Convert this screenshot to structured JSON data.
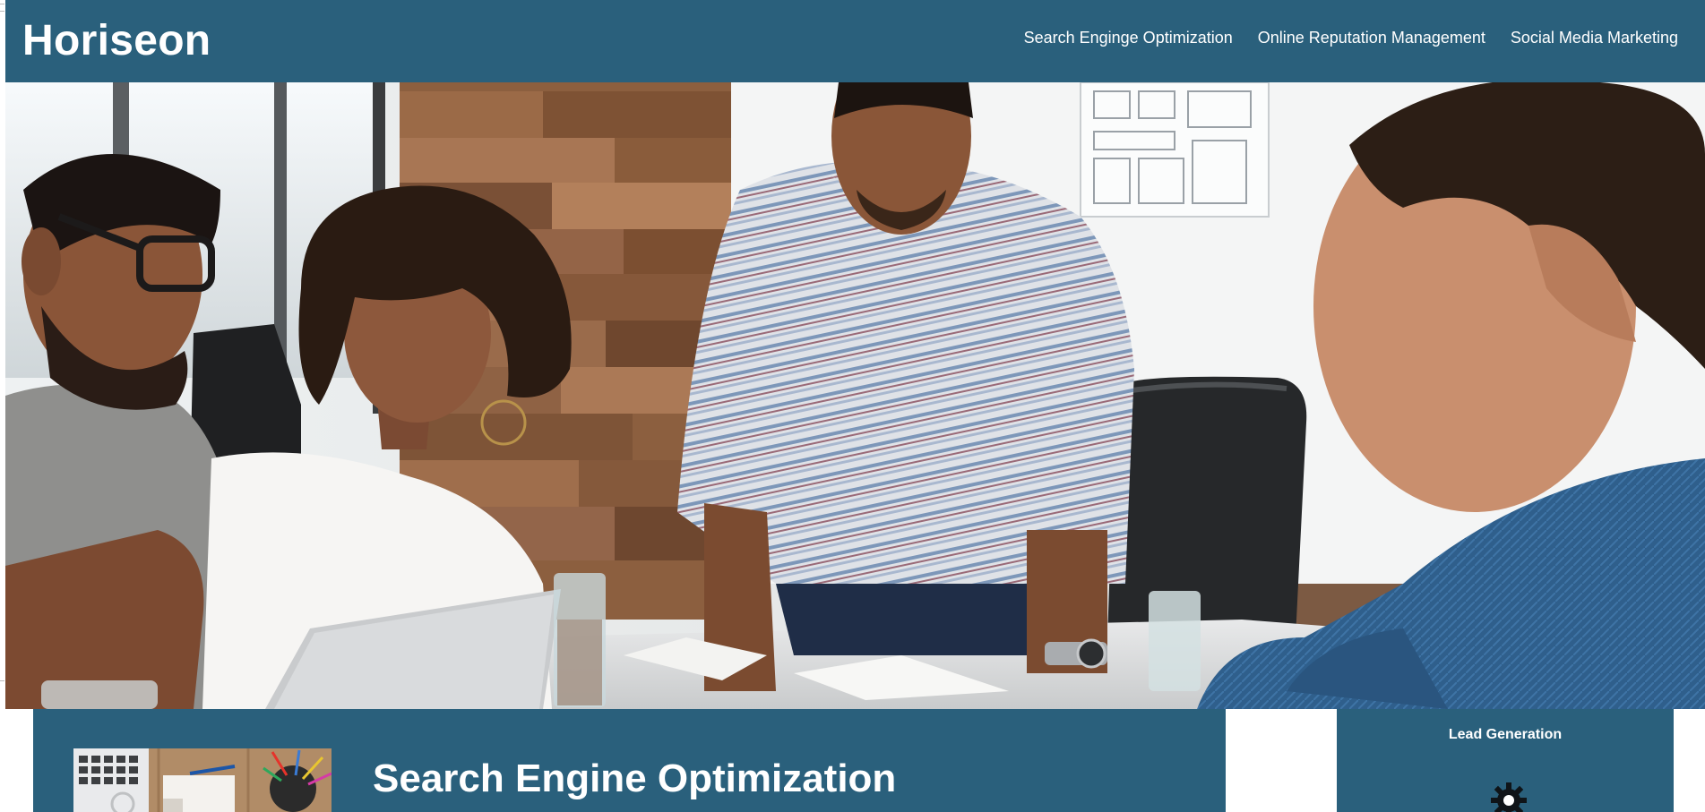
{
  "header": {
    "logo": "Horiseon",
    "nav": [
      {
        "label": "Search Enginge Optimization"
      },
      {
        "label": "Online Reputation Management"
      },
      {
        "label": "Social Media Marketing"
      }
    ]
  },
  "hero": {
    "image_alt": "Team of four colleagues gathered around a meeting table with a laptop"
  },
  "content": {
    "title": "Search Engine Optimization",
    "thumbnail_alt": "Desk with keyboard, notebook and pens"
  },
  "aside": {
    "title": "Lead Generation",
    "icon": "gear-icon"
  },
  "colors": {
    "brand": "#2a607c",
    "text_on_brand": "#ffffff"
  }
}
